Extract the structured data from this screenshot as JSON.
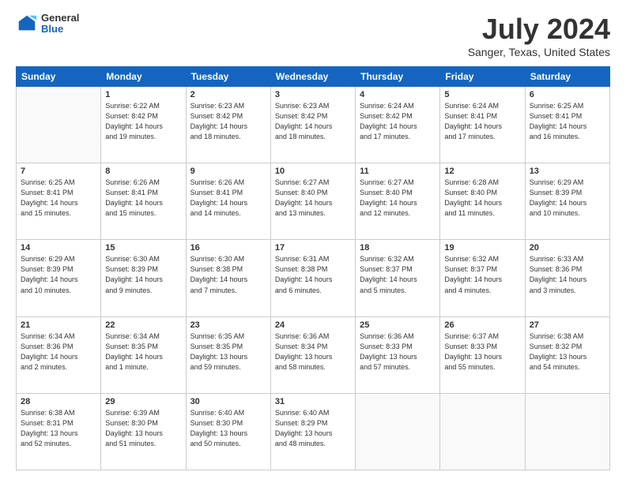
{
  "header": {
    "logo": {
      "general": "General",
      "blue": "Blue"
    },
    "title": "July 2024",
    "subtitle": "Sanger, Texas, United States"
  },
  "days_of_week": [
    "Sunday",
    "Monday",
    "Tuesday",
    "Wednesday",
    "Thursday",
    "Friday",
    "Saturday"
  ],
  "weeks": [
    [
      {
        "day": "",
        "info": ""
      },
      {
        "day": "1",
        "info": "Sunrise: 6:22 AM\nSunset: 8:42 PM\nDaylight: 14 hours\nand 19 minutes."
      },
      {
        "day": "2",
        "info": "Sunrise: 6:23 AM\nSunset: 8:42 PM\nDaylight: 14 hours\nand 18 minutes."
      },
      {
        "day": "3",
        "info": "Sunrise: 6:23 AM\nSunset: 8:42 PM\nDaylight: 14 hours\nand 18 minutes."
      },
      {
        "day": "4",
        "info": "Sunrise: 6:24 AM\nSunset: 8:42 PM\nDaylight: 14 hours\nand 17 minutes."
      },
      {
        "day": "5",
        "info": "Sunrise: 6:24 AM\nSunset: 8:41 PM\nDaylight: 14 hours\nand 17 minutes."
      },
      {
        "day": "6",
        "info": "Sunrise: 6:25 AM\nSunset: 8:41 PM\nDaylight: 14 hours\nand 16 minutes."
      }
    ],
    [
      {
        "day": "7",
        "info": "Sunrise: 6:25 AM\nSunset: 8:41 PM\nDaylight: 14 hours\nand 15 minutes."
      },
      {
        "day": "8",
        "info": "Sunrise: 6:26 AM\nSunset: 8:41 PM\nDaylight: 14 hours\nand 15 minutes."
      },
      {
        "day": "9",
        "info": "Sunrise: 6:26 AM\nSunset: 8:41 PM\nDaylight: 14 hours\nand 14 minutes."
      },
      {
        "day": "10",
        "info": "Sunrise: 6:27 AM\nSunset: 8:40 PM\nDaylight: 14 hours\nand 13 minutes."
      },
      {
        "day": "11",
        "info": "Sunrise: 6:27 AM\nSunset: 8:40 PM\nDaylight: 14 hours\nand 12 minutes."
      },
      {
        "day": "12",
        "info": "Sunrise: 6:28 AM\nSunset: 8:40 PM\nDaylight: 14 hours\nand 11 minutes."
      },
      {
        "day": "13",
        "info": "Sunrise: 6:29 AM\nSunset: 8:39 PM\nDaylight: 14 hours\nand 10 minutes."
      }
    ],
    [
      {
        "day": "14",
        "info": "Sunrise: 6:29 AM\nSunset: 8:39 PM\nDaylight: 14 hours\nand 10 minutes."
      },
      {
        "day": "15",
        "info": "Sunrise: 6:30 AM\nSunset: 8:39 PM\nDaylight: 14 hours\nand 9 minutes."
      },
      {
        "day": "16",
        "info": "Sunrise: 6:30 AM\nSunset: 8:38 PM\nDaylight: 14 hours\nand 7 minutes."
      },
      {
        "day": "17",
        "info": "Sunrise: 6:31 AM\nSunset: 8:38 PM\nDaylight: 14 hours\nand 6 minutes."
      },
      {
        "day": "18",
        "info": "Sunrise: 6:32 AM\nSunset: 8:37 PM\nDaylight: 14 hours\nand 5 minutes."
      },
      {
        "day": "19",
        "info": "Sunrise: 6:32 AM\nSunset: 8:37 PM\nDaylight: 14 hours\nand 4 minutes."
      },
      {
        "day": "20",
        "info": "Sunrise: 6:33 AM\nSunset: 8:36 PM\nDaylight: 14 hours\nand 3 minutes."
      }
    ],
    [
      {
        "day": "21",
        "info": "Sunrise: 6:34 AM\nSunset: 8:36 PM\nDaylight: 14 hours\nand 2 minutes."
      },
      {
        "day": "22",
        "info": "Sunrise: 6:34 AM\nSunset: 8:35 PM\nDaylight: 14 hours\nand 1 minute."
      },
      {
        "day": "23",
        "info": "Sunrise: 6:35 AM\nSunset: 8:35 PM\nDaylight: 13 hours\nand 59 minutes."
      },
      {
        "day": "24",
        "info": "Sunrise: 6:36 AM\nSunset: 8:34 PM\nDaylight: 13 hours\nand 58 minutes."
      },
      {
        "day": "25",
        "info": "Sunrise: 6:36 AM\nSunset: 8:33 PM\nDaylight: 13 hours\nand 57 minutes."
      },
      {
        "day": "26",
        "info": "Sunrise: 6:37 AM\nSunset: 8:33 PM\nDaylight: 13 hours\nand 55 minutes."
      },
      {
        "day": "27",
        "info": "Sunrise: 6:38 AM\nSunset: 8:32 PM\nDaylight: 13 hours\nand 54 minutes."
      }
    ],
    [
      {
        "day": "28",
        "info": "Sunrise: 6:38 AM\nSunset: 8:31 PM\nDaylight: 13 hours\nand 52 minutes."
      },
      {
        "day": "29",
        "info": "Sunrise: 6:39 AM\nSunset: 8:30 PM\nDaylight: 13 hours\nand 51 minutes."
      },
      {
        "day": "30",
        "info": "Sunrise: 6:40 AM\nSunset: 8:30 PM\nDaylight: 13 hours\nand 50 minutes."
      },
      {
        "day": "31",
        "info": "Sunrise: 6:40 AM\nSunset: 8:29 PM\nDaylight: 13 hours\nand 48 minutes."
      },
      {
        "day": "",
        "info": ""
      },
      {
        "day": "",
        "info": ""
      },
      {
        "day": "",
        "info": ""
      }
    ]
  ]
}
